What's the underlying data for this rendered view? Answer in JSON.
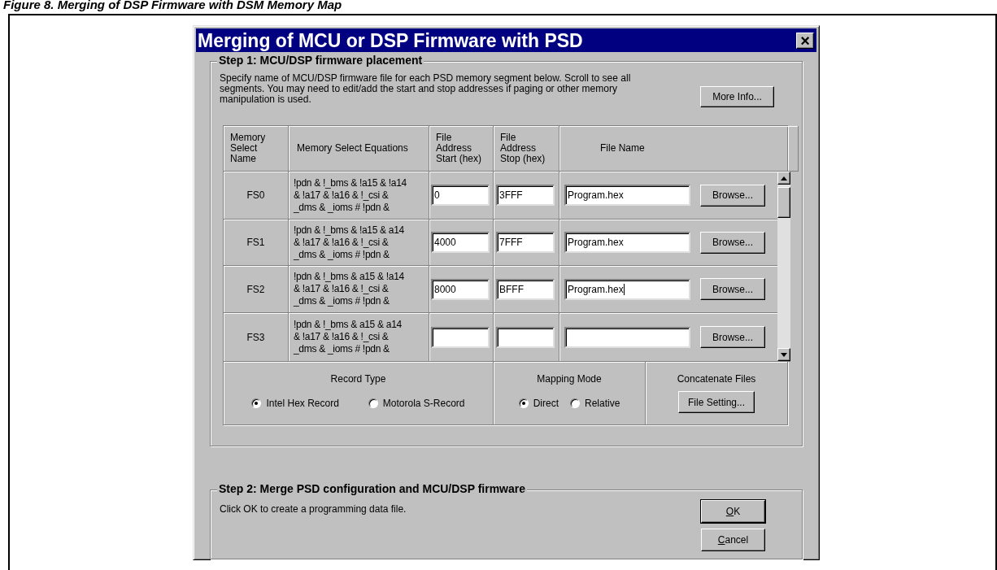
{
  "caption": "Figure 8. Merging of DSP Firmware with DSM Memory Map",
  "dialog": {
    "title": "Merging of MCU or DSP Firmware with PSD",
    "close": "×"
  },
  "step1": {
    "title": "Step 1: MCU/DSP firmware placement",
    "description": "Specify name of MCU/DSP firmware file for each PSD memory segment below. Scroll to see all segments. You may need to edit/add the start and stop addresses if paging or other memory manipulation is used.",
    "more_info": "More Info...",
    "table": {
      "columns": [
        "Memory\nSelect\nName",
        "Memory Select Equations",
        "File\nAddress\nStart (hex)",
        "File\nAddress\nStop (hex)",
        "File Name"
      ],
      "rows": [
        {
          "name": "FS0",
          "equation": "!pdn & !_bms & !a15 & !a14\n& !a17 & !a16 & !_csi &\n_dms & _ioms # !pdn &",
          "start": "0",
          "stop": "3FFF",
          "file": "Program.hex",
          "focused": false,
          "browse": "Browse..."
        },
        {
          "name": "FS1",
          "equation": "!pdn & !_bms & !a15 & a14\n& !a17 & !a16 & !_csi &\n_dms & _ioms # !pdn &",
          "start": "4000",
          "stop": "7FFF",
          "file": "Program.hex",
          "focused": false,
          "browse": "Browse..."
        },
        {
          "name": "FS2",
          "equation": "!pdn & !_bms & a15 & !a14\n& !a17 & !a16 & !_csi &\n_dms & _ioms # !pdn &",
          "start": "8000",
          "stop": "BFFF",
          "file": "Program.hex",
          "focused": true,
          "browse": "Browse..."
        },
        {
          "name": "FS3",
          "equation": "!pdn & !_bms & a15 & a14\n& !a17 & !a16 & !_csi &\n_dms & _ioms # !pdn &",
          "focused": false,
          "browse": "Browse..."
        }
      ]
    },
    "record_type": {
      "label": "Record Type",
      "options": [
        {
          "label": "Intel Hex Record",
          "selected": true
        },
        {
          "label": "Motorola S-Record",
          "selected": false
        }
      ]
    },
    "mapping_mode": {
      "label": "Mapping Mode",
      "options": [
        {
          "label": "Direct",
          "selected": true
        },
        {
          "label": "Relative",
          "selected": false
        }
      ]
    },
    "concatenate": {
      "label": "Concatenate Files",
      "button": "File Setting..."
    }
  },
  "step2": {
    "title": "Step 2: Merge PSD configuration and MCU/DSP firmware",
    "text": "Click OK to create a programming data file.",
    "buttons": [
      {
        "label": "OK",
        "underline_first": true,
        "default": true
      },
      {
        "label": "Cancel",
        "underline_first": true,
        "default": false
      }
    ]
  }
}
